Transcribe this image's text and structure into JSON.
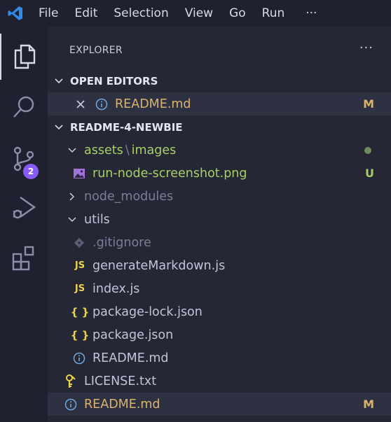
{
  "menu": [
    "File",
    "Edit",
    "Selection",
    "View",
    "Go",
    "Run"
  ],
  "menu_more": "···",
  "activity": {
    "scm_badge": "2"
  },
  "explorer": {
    "title": "EXPLORER",
    "more": "···",
    "open_editors": {
      "header": "OPEN EDITORS",
      "items": [
        {
          "name": "README.md",
          "status": "M"
        }
      ]
    },
    "project": {
      "header": "README-4-NEWBIE",
      "tree": {
        "assets_folder": "assets",
        "separator": "\\",
        "images_folder": "images",
        "screenshot_file": "run-node-screenshot.png",
        "screenshot_status": "U",
        "node_modules": "node_modules",
        "utils": "utils",
        "gitignore": ".gitignore",
        "generate_markdown": "generateMarkdown.js",
        "index_js": "index.js",
        "package_lock": "package-lock.json",
        "package_json": "package.json",
        "utils_readme": "README.md",
        "license": "LICENSE.txt",
        "root_readme": "README.md",
        "root_readme_status": "M"
      }
    }
  },
  "colors": {
    "background": "#252734",
    "activity_bar": "#1f2130",
    "modified": "#d9b36c",
    "untracked": "#a7d06a",
    "badge": "#8a5cf6",
    "vscode_blue": "#2f8be6"
  }
}
